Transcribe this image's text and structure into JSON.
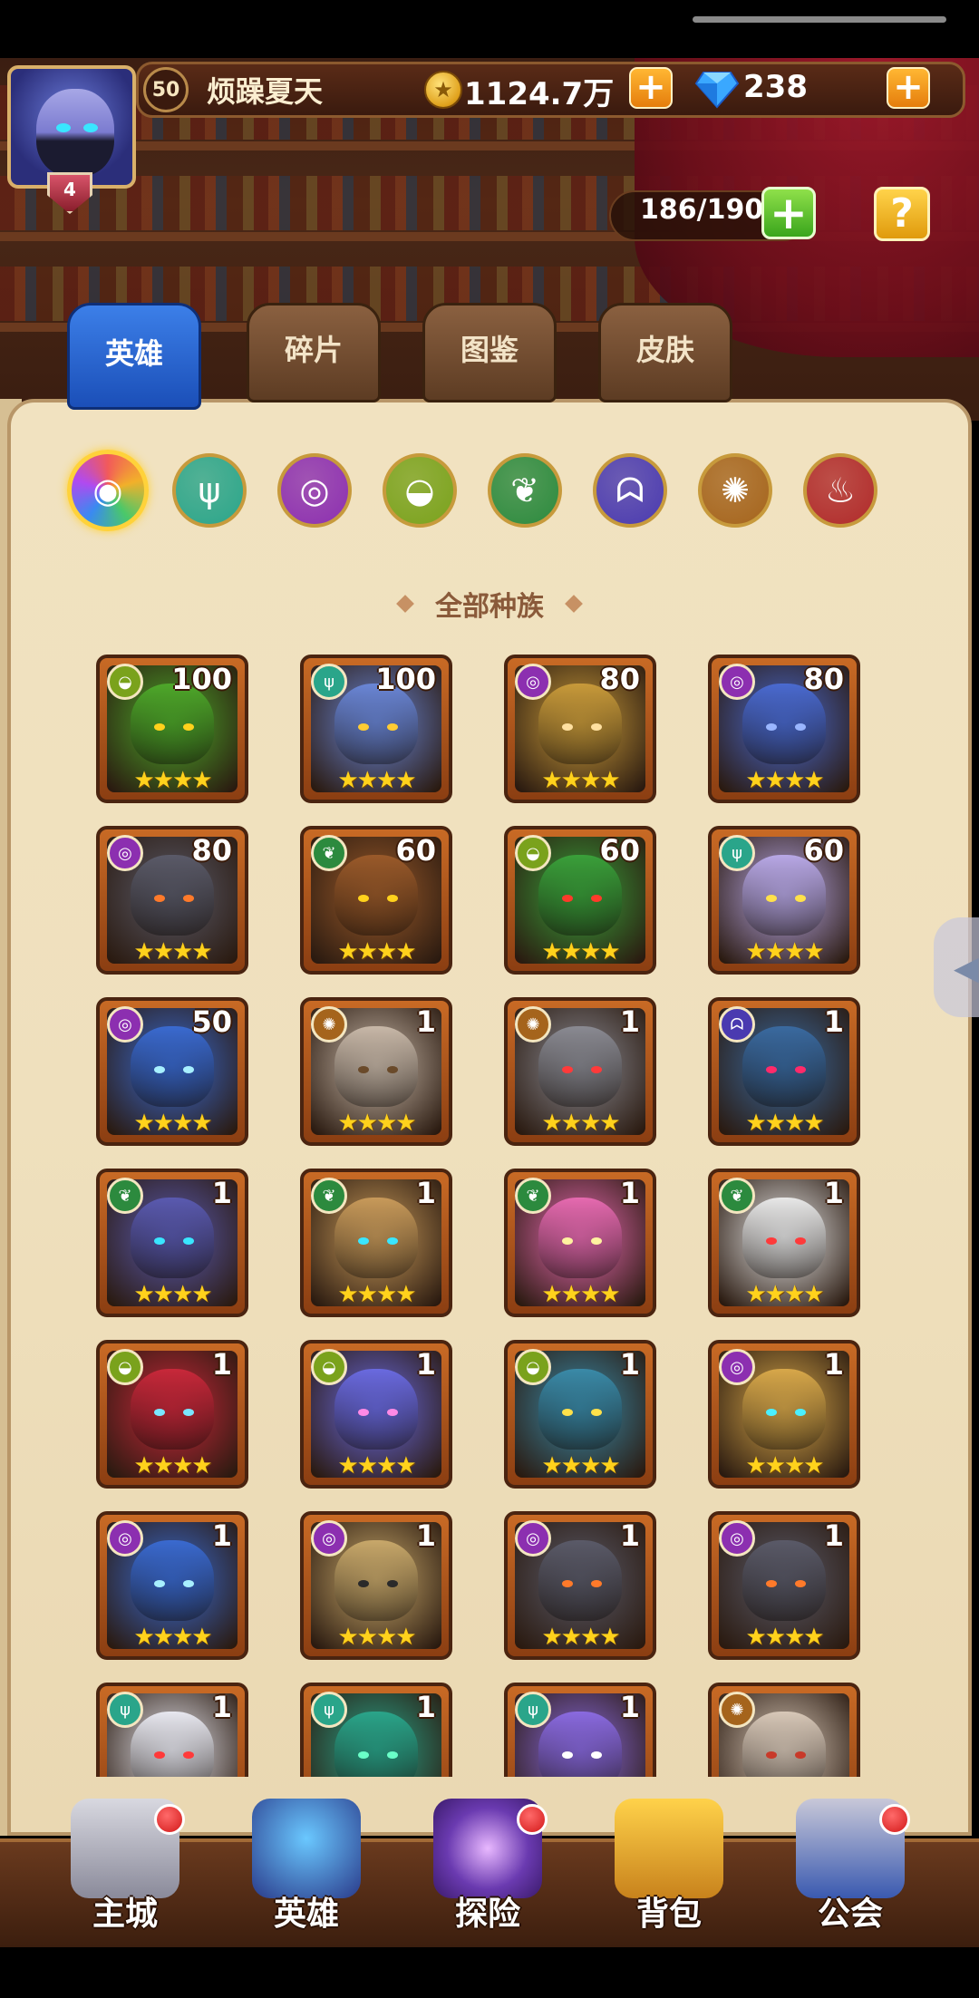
{
  "player": {
    "level": "50",
    "name": "烦躁夏天",
    "rank": "4"
  },
  "resources": {
    "gold": "1124.7万",
    "gems": "238"
  },
  "capacity": "186/190",
  "tabs": [
    "英雄",
    "碎片",
    "图鉴",
    "皮肤"
  ],
  "race_filter": {
    "title": "全部种族",
    "races": [
      {
        "name": "all-races",
        "color": "#f25a5a"
      },
      {
        "name": "forest",
        "color": "#2aa58a"
      },
      {
        "name": "shadow",
        "color": "#8c2fb0"
      },
      {
        "name": "fortress",
        "color": "#7aa21c"
      },
      {
        "name": "nature",
        "color": "#2c8a3e"
      },
      {
        "name": "abyss",
        "color": "#4a3ab0"
      },
      {
        "name": "light",
        "color": "#a5641c"
      },
      {
        "name": "dark",
        "color": "#b02a2a"
      }
    ]
  },
  "heroes": [
    {
      "level": "100",
      "race": "fortress",
      "stars": "★★★★",
      "color": "#4ea82a",
      "eye": "#ffd21c"
    },
    {
      "level": "100",
      "race": "forest",
      "stars": "★★★★",
      "color": "#6a86d6",
      "eye": "#ffcc33"
    },
    {
      "level": "80",
      "race": "shadow",
      "stars": "★★★★",
      "color": "#c89a3a",
      "eye": "#ffe0a0"
    },
    {
      "level": "80",
      "race": "shadow",
      "stars": "★★★★",
      "color": "#4a6ad0",
      "eye": "#9ab6ff"
    },
    {
      "level": "80",
      "race": "shadow",
      "stars": "★★★★",
      "color": "#5a5a68",
      "eye": "#ff7a2a"
    },
    {
      "level": "60",
      "race": "nature",
      "stars": "★★★★",
      "color": "#9a5a2a",
      "eye": "#ffd21c"
    },
    {
      "level": "60",
      "race": "fortress",
      "stars": "★★★★",
      "color": "#3aa03a",
      "eye": "#ff3a2a"
    },
    {
      "level": "60",
      "race": "forest",
      "stars": "★★★★",
      "color": "#b8a8e6",
      "eye": "#ffe14a"
    },
    {
      "level": "50",
      "race": "shadow",
      "stars": "★★★★",
      "color": "#3a6ad0",
      "eye": "#a8f0ff"
    },
    {
      "level": "1",
      "race": "light",
      "stars": "★★★★",
      "color": "#c8b8a8",
      "eye": "#6a4a2a"
    },
    {
      "level": "1",
      "race": "light",
      "stars": "★★★★",
      "color": "#8a8a92",
      "eye": "#ff3a3a"
    },
    {
      "level": "1",
      "race": "abyss",
      "stars": "★★★★",
      "color": "#3a6aa0",
      "eye": "#ff2a6a"
    },
    {
      "level": "1",
      "race": "nature",
      "stars": "★★★★",
      "color": "#5a5ab0",
      "eye": "#39e6ff"
    },
    {
      "level": "1",
      "race": "nature",
      "stars": "★★★★",
      "color": "#c89a5a",
      "eye": "#39e6ff"
    },
    {
      "level": "1",
      "race": "nature",
      "stars": "★★★★",
      "color": "#e66ab0",
      "eye": "#fff2a0"
    },
    {
      "level": "1",
      "race": "nature",
      "stars": "★★★★",
      "color": "#e8e8e8",
      "eye": "#ff3a3a"
    },
    {
      "level": "1",
      "race": "fortress",
      "stars": "★★★★",
      "color": "#c8283a",
      "eye": "#7ae6ff"
    },
    {
      "level": "1",
      "race": "fortress",
      "stars": "★★★★",
      "color": "#6a6ae0",
      "eye": "#ff8ae6"
    },
    {
      "level": "1",
      "race": "fortress",
      "stars": "★★★★",
      "color": "#3a8aa8",
      "eye": "#ffe14a"
    },
    {
      "level": "1",
      "race": "shadow",
      "stars": "★★★★",
      "color": "#d8a84a",
      "eye": "#4af0ff"
    },
    {
      "level": "1",
      "race": "shadow",
      "stars": "★★★★",
      "color": "#3a6ad0",
      "eye": "#a8f0ff"
    },
    {
      "level": "1",
      "race": "shadow",
      "stars": "★★★★",
      "color": "#c8a86a",
      "eye": "#2a2a2a"
    },
    {
      "level": "1",
      "race": "shadow",
      "stars": "★★★★",
      "color": "#5a5a68",
      "eye": "#ff7a2a"
    },
    {
      "level": "1",
      "race": "shadow",
      "stars": "★★★★",
      "color": "#5a5a68",
      "eye": "#ff7a2a"
    },
    {
      "level": "1",
      "race": "forest",
      "stars": "★★★★",
      "color": "#e8e8f0",
      "eye": "#ff3a3a"
    },
    {
      "level": "1",
      "race": "forest",
      "stars": "★★★★",
      "color": "#2aa58a",
      "eye": "#6affc8"
    },
    {
      "level": "1",
      "race": "forest",
      "stars": "★★★★",
      "color": "#8a6ae0",
      "eye": "#ffffff"
    },
    {
      "level": "",
      "race": "light",
      "stars": "★★★★",
      "color": "#d8c8b8",
      "eye": "#c83a2a"
    }
  ],
  "nav": [
    {
      "label": "主城",
      "icon": "castle-icon",
      "dot": true
    },
    {
      "label": "英雄",
      "icon": "hero-icon",
      "dot": false
    },
    {
      "label": "探险",
      "icon": "portal-icon",
      "dot": true
    },
    {
      "label": "背包",
      "icon": "backpack-icon",
      "dot": false
    },
    {
      "label": "公会",
      "icon": "guild-icon",
      "dot": true
    }
  ]
}
